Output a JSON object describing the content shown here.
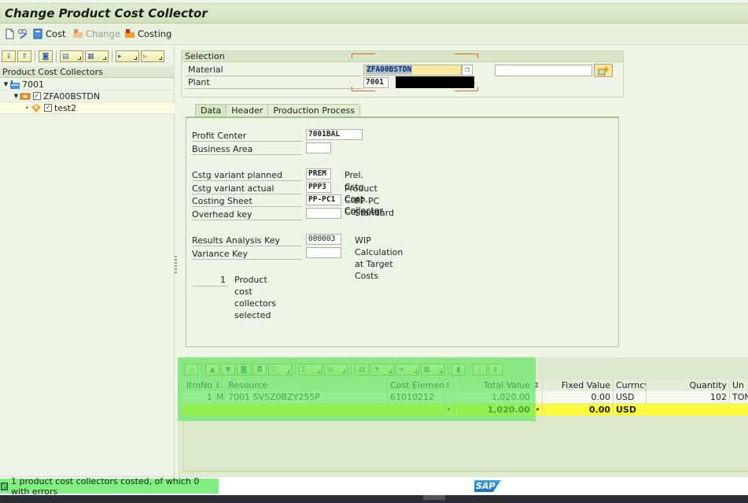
{
  "window": {
    "title": "Change Product Cost Collector"
  },
  "app_toolbar": {
    "items": [
      {
        "label": "",
        "icon": "new-document-icon"
      },
      {
        "label": "",
        "icon": "display-change-icon"
      },
      {
        "label": "Cost",
        "icon": "calculator-icon"
      },
      {
        "label": "Change",
        "icon": "costing-change-icon",
        "disabled": true
      },
      {
        "label": "Costing",
        "icon": "costing-icon"
      }
    ]
  },
  "left_pane": {
    "tree_header": "Product Cost Collectors",
    "tree": [
      {
        "label": "7001",
        "icon": "plant-icon",
        "level": 0
      },
      {
        "label": "ZFA00BSTDN",
        "icon": "material-icon",
        "level": 1,
        "checked": true
      },
      {
        "label": "test2",
        "icon": "cost-collector-icon",
        "level": 2,
        "checked": true,
        "selected": true
      }
    ]
  },
  "selection": {
    "title": "Selection",
    "material_label": "Material",
    "material_value": "ZFA00BSTDN",
    "plant_label": "Plant",
    "plant_value": "7001",
    "extra_input_value": ""
  },
  "tabs": [
    {
      "label": "Data",
      "active": true
    },
    {
      "label": "Header",
      "active": false
    },
    {
      "label": "Production Process",
      "active": false
    }
  ],
  "data_tab": {
    "profit_center": {
      "label": "Profit Center",
      "value": "7001BAL"
    },
    "business_area": {
      "label": "Business Area",
      "value": ""
    },
    "cstg_variant_planned": {
      "label": "Cstg variant planned",
      "value": "PREM",
      "desc": "Prel. Cstg Cost Collector"
    },
    "cstg_variant_actual": {
      "label": "Cstg variant actual",
      "value": "PPP3",
      "desc": "Product Cost Collector"
    },
    "costing_sheet": {
      "label": "Costing Sheet",
      "value": "PP-PC1",
      "desc": "PP-PC Standard"
    },
    "overhead_key": {
      "label": "Overhead key",
      "value": ""
    },
    "results_analysis_key": {
      "label": "Results Analysis Key",
      "value": "000003",
      "desc": "WIP Calculation at Target Costs"
    },
    "variance_key": {
      "label": "Variance Key",
      "value": ""
    },
    "selected_count": "1",
    "selected_text": "Product cost collectors selected"
  },
  "alv": {
    "columns": [
      "ItmNo",
      "I...",
      "Resource",
      "Cost Element",
      "Σ",
      "Total Value",
      "Σ",
      "Fixed Value",
      "Currncy",
      "Quantity",
      "Un"
    ],
    "rows": [
      {
        "itmno": "1",
        "i": "M",
        "resource": "7001 SVSZ0BZY255P",
        "cost_element": "61010212",
        "total_value": "1,020.00",
        "fixed_value": "0.00",
        "currency": "USD",
        "quantity": "102",
        "unit": "TON"
      }
    ],
    "totals": {
      "sum_marker": "•",
      "total_value": "1,020.00",
      "fixed_value": "0.00",
      "currency": "USD"
    }
  },
  "status": {
    "message": "1 product cost collectors costed, of which 0 with errors",
    "type": "success",
    "logo": "SAP"
  }
}
